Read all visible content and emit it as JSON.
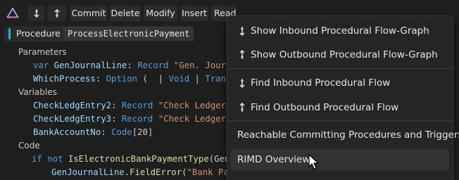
{
  "toolbar": {
    "logo_icon": "triangle-logo-icon",
    "commit": "Commit",
    "delete": "Delete",
    "modify": "Modify",
    "insert": "Insert",
    "read": "Read"
  },
  "procedure": {
    "label": "Procedure",
    "name": "ProcessElectronicPayment"
  },
  "code": {
    "parameters_header": "Parameters",
    "params": [
      {
        "var_kw": "var",
        "name": "GenJournalLine",
        "colon": ":",
        "type": "Record",
        "value": "\"Gen. Journa"
      },
      {
        "name": "WhichProcess",
        "colon": ":",
        "type": "Option",
        "rest_open": " (  ",
        "rest_bar": "|",
        "rest_void": " Void ",
        "rest_bar2": "|",
        "rest_trans": " Trans"
      }
    ],
    "variables_header": "Variables",
    "vars": [
      {
        "name": "CheckLedgEntry2",
        "colon": ":",
        "type": "Record",
        "value": "\"Check Ledger"
      },
      {
        "name": "CheckLedgEntry3",
        "colon": ":",
        "type": "Record",
        "value": "\"Check Ledger"
      },
      {
        "name": "BankAccountNo",
        "colon": ":",
        "type": "Code",
        "size": "[20]"
      }
    ],
    "code_header": "Code",
    "stmt1": {
      "kw_if": "if",
      "kw_not": "not",
      "func": "IsElectronicBankPaymentType",
      "args": "(GenJ"
    },
    "stmt2": {
      "obj": "GenJournalLine",
      "dot": ".",
      "method": "FieldError",
      "args_open": "(",
      "str": "\"Bank Payment Type\"",
      "args_close": ");"
    }
  },
  "menu": {
    "items": [
      {
        "label": "Show Inbound Procedural Flow-Graph",
        "icon": "arrow-down-icon"
      },
      {
        "label": "Show Outbound Procedural Flow-Graph",
        "icon": "arrow-up-icon"
      },
      {
        "label": "Find Inbound Procedural Flow",
        "icon": "arrow-down-icon"
      },
      {
        "label": "Find Outbound Procedural Flow",
        "icon": "arrow-up-icon"
      },
      {
        "label": "Reachable Committing Procedures and Triggers"
      },
      {
        "label": "RIMD Overview"
      }
    ]
  },
  "colors": {
    "accent": "#21b3c9",
    "logo": "#c586c0",
    "variable": "#9cdcfe",
    "keyword": "#569cd6",
    "string": "#ce9178",
    "type": "#4ec9b0",
    "function": "#dcdcaa"
  }
}
